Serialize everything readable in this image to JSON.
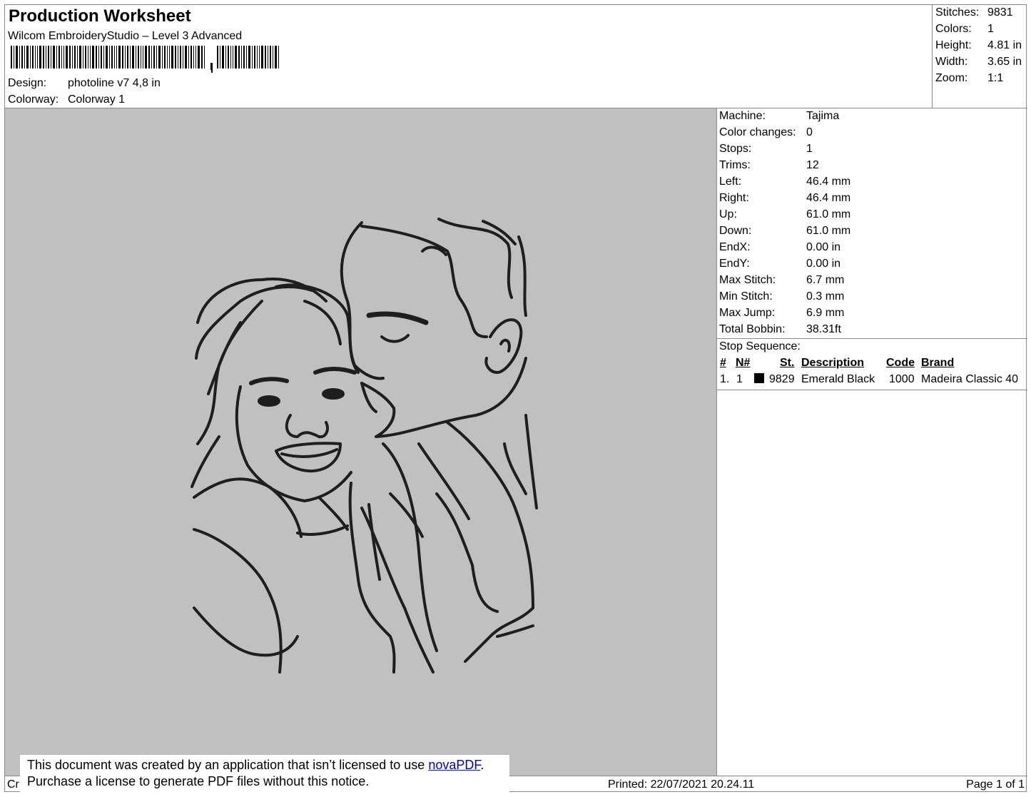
{
  "header": {
    "title": "Production Worksheet",
    "subtitle": "Wilcom EmbroideryStudio – Level 3 Advanced",
    "design_label": "Design:",
    "design_value": "photoline v7 4,8 in",
    "colorway_label": "Colorway:",
    "colorway_value": "Colorway 1"
  },
  "stats": [
    {
      "label": "Stitches:",
      "value": "9831"
    },
    {
      "label": "Colors:",
      "value": "1"
    },
    {
      "label": "Height:",
      "value": "4.81 in"
    },
    {
      "label": "Width:",
      "value": "3.65 in"
    },
    {
      "label": "Zoom:",
      "value": "1:1"
    }
  ],
  "info": [
    {
      "label": "Machine:",
      "value": "Tajima"
    },
    {
      "label": "Color changes:",
      "value": "0"
    },
    {
      "label": "Stops:",
      "value": "1"
    },
    {
      "label": "Trims:",
      "value": "12"
    },
    {
      "label": "Left:",
      "value": "46.4 mm"
    },
    {
      "label": "Right:",
      "value": "46.4 mm"
    },
    {
      "label": "Up:",
      "value": "61.0 mm"
    },
    {
      "label": "Down:",
      "value": "61.0 mm"
    },
    {
      "label": "EndX:",
      "value": "0.00 in"
    },
    {
      "label": "EndY:",
      "value": "0.00 in"
    },
    {
      "label": "Max Stitch:",
      "value": "6.7 mm"
    },
    {
      "label": "Min Stitch:",
      "value": "0.3 mm"
    },
    {
      "label": "Max Jump:",
      "value": "6.9 mm"
    },
    {
      "label": "Total Bobbin:",
      "value": "38.31ft"
    }
  ],
  "stop_sequence": {
    "title": "Stop Sequence:",
    "headers": {
      "index": "#",
      "needle": "N#",
      "stitches": "St.",
      "description": "Description",
      "code": "Code",
      "brand": "Brand"
    },
    "rows": [
      {
        "index": "1.",
        "needle": "1",
        "swatch_color": "#000000",
        "stitches": "9829",
        "description": "Emerald Black",
        "code": "1000",
        "brand": "Madeira Classic 40"
      }
    ]
  },
  "footer": {
    "created": "Cr",
    "printed": "Printed: 22/07/2021 20.24.11",
    "page": "Page 1 of 1"
  },
  "notice": {
    "line1_before": "This document was created by an application that isn’t licensed to use ",
    "link": "novaPDF",
    "line1_after": ".",
    "line2": "Purchase a license to generate PDF files without this notice."
  },
  "colors": {
    "canvas": "#c0c0c0",
    "thread": "#1e1e1e"
  }
}
